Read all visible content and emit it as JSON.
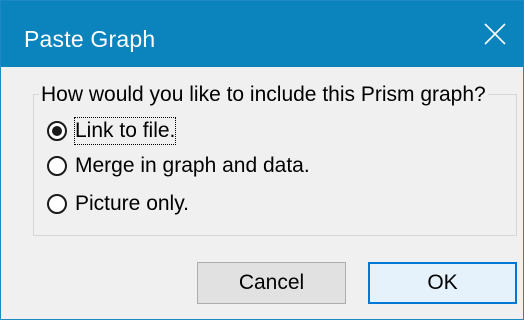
{
  "window": {
    "title": "Paste Graph",
    "close_icon": "close-icon"
  },
  "group": {
    "legend": "How would you like to include this Prism graph?",
    "options": [
      {
        "label": "Link to file.",
        "selected": true
      },
      {
        "label": "Merge in graph and data.",
        "selected": false
      },
      {
        "label": "Picture only.",
        "selected": false
      }
    ]
  },
  "buttons": {
    "cancel_label": "Cancel",
    "ok_label": "OK"
  },
  "colors": {
    "titlebar": "#0b83bd",
    "dialog_bg": "#f0f0f0",
    "ok_border": "#0078d7"
  }
}
